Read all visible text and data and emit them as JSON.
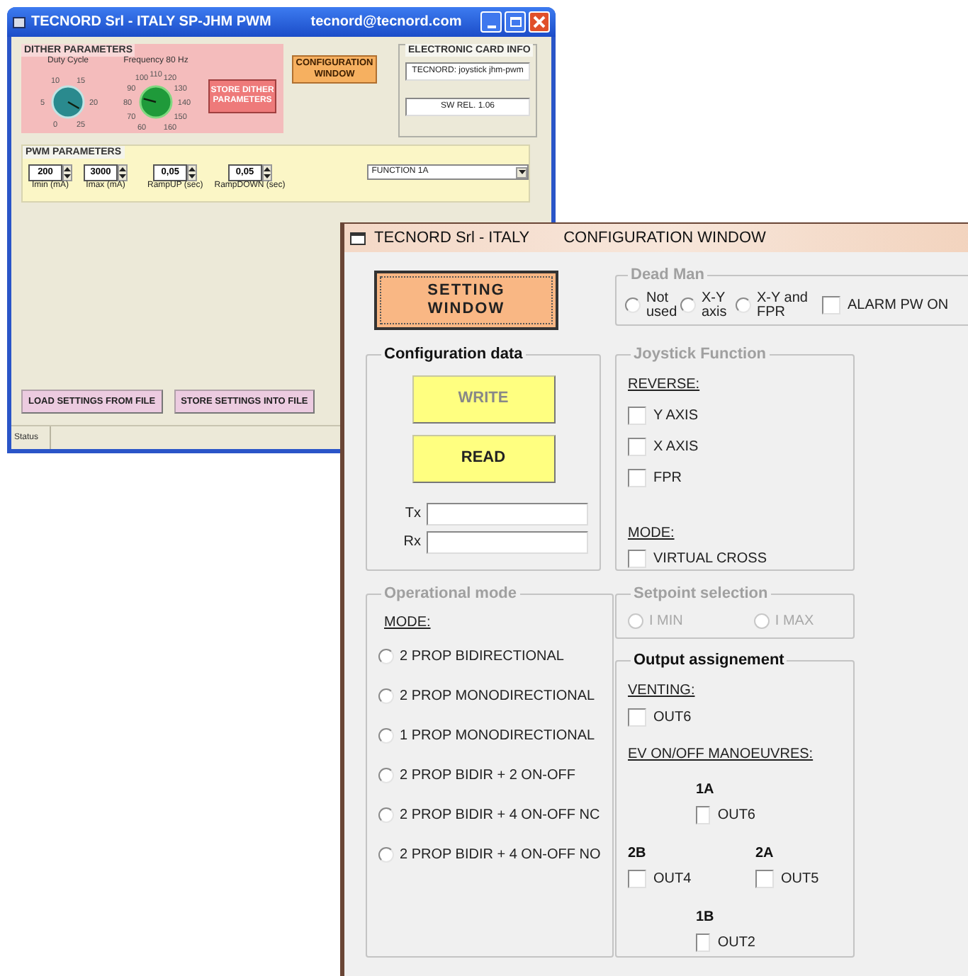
{
  "main_window": {
    "title": "TECNORD Srl -  ITALY   SP-JHM PWM",
    "email": "tecnord@tecnord.com",
    "dither": {
      "title": "DITHER PARAMETERS",
      "knobs": [
        {
          "label": "Duty Cycle",
          "scale": [
            "10",
            "15",
            "5",
            "20",
            "0",
            "25"
          ]
        },
        {
          "label": "Frequency  80 Hz",
          "scale": [
            "110",
            "100",
            "120",
            "90",
            "130",
            "80",
            "140",
            "70",
            "150",
            "60",
            "160"
          ]
        }
      ],
      "store_button": "STORE DITHER PARAMETERS"
    },
    "config_button": "CONFIGURATION WINDOW",
    "card_info": {
      "title": "ELECTRONIC CARD INFO",
      "fields": [
        "TECNORD: joystick jhm-pwm",
        "SW REL.  1.06"
      ]
    },
    "pwm": {
      "title": "PWM PARAMETERS",
      "spinners": [
        {
          "value": "200",
          "label": "Imin (mA)"
        },
        {
          "value": "3000",
          "label": "Imax (mA)"
        },
        {
          "value": "0,05",
          "label": "RampUP (sec)"
        },
        {
          "value": "0,05",
          "label": "RampDOWN (sec)"
        }
      ],
      "function": "FUNCTION 1A"
    },
    "buttons": [
      "LOAD SETTINGS FROM FILE",
      "STORE SETTINGS INTO FILE"
    ],
    "status_bar": "Status"
  },
  "config_window": {
    "title": "TECNORD Srl - ITALY",
    "subtitle": "CONFIGURATION WINDOW",
    "setting_button": "SETTING WINDOW",
    "dead_man": {
      "title": "Dead Man",
      "disabled": true,
      "options": [
        {
          "label": "Not used",
          "selected": false
        },
        {
          "label": "X-Y axis",
          "selected": false
        },
        {
          "label": "X-Y and FPR",
          "selected": false
        }
      ],
      "alarm": {
        "label": "ALARM PW ON",
        "checked": false
      }
    },
    "config_data": {
      "title": "Configuration data",
      "disabled": false,
      "buttons": [
        {
          "label": "WRITE",
          "disabled": true
        },
        {
          "label": "READ",
          "disabled": false
        }
      ],
      "fields": [
        {
          "label": "Tx"
        },
        {
          "label": "Rx"
        }
      ]
    },
    "joystick": {
      "title": "Joystick Function",
      "disabled": true,
      "reverse_label": "REVERSE:",
      "reverse": [
        {
          "label": "Y AXIS",
          "checked": false
        },
        {
          "label": "X AXIS",
          "checked": false
        },
        {
          "label": "FPR",
          "checked": false
        }
      ],
      "mode_label": "MODE:",
      "mode": [
        {
          "label": "VIRTUAL CROSS",
          "checked": false
        }
      ]
    },
    "operational_mode": {
      "title": "Operational mode",
      "disabled": true,
      "mode_label": "MODE:",
      "options": [
        {
          "label": "2 PROP BIDIRECTIONAL",
          "selected": false
        },
        {
          "label": "2 PROP MONODIRECTIONAL",
          "selected": false
        },
        {
          "label": "1 PROP MONODIRECTIONAL",
          "selected": false
        },
        {
          "label": "2 PROP BIDIR + 2 ON-OFF",
          "selected": false
        },
        {
          "label": "2 PROP BIDIR + 4 ON-OFF NC",
          "selected": false
        },
        {
          "label": "2 PROP BIDIR + 4 ON-OFF NO",
          "selected": false
        }
      ]
    },
    "setpoint": {
      "title": "Setpoint selection",
      "disabled": true,
      "options": [
        {
          "label": "I MIN",
          "selected": false,
          "disabled": true
        },
        {
          "label": "I MAX",
          "selected": false,
          "disabled": true
        }
      ]
    },
    "output": {
      "title": "Output assignement",
      "disabled": false,
      "venting_label": "VENTING:",
      "venting": [
        {
          "label": "OUT6",
          "checked": false
        }
      ],
      "ev_label": "EV ON/OFF MANOEUVRES:",
      "outputs": [
        {
          "name": "1A",
          "label": "OUT6",
          "checked": false
        },
        {
          "name": "2B",
          "label": "OUT4",
          "checked": false
        },
        {
          "name": "2A",
          "label": "OUT5",
          "checked": false
        },
        {
          "name": "1B",
          "label": "OUT2",
          "checked": false
        }
      ]
    }
  }
}
